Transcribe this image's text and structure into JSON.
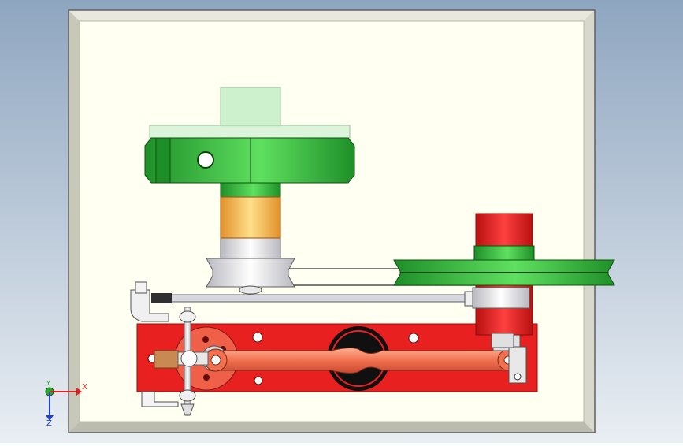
{
  "viewport": {
    "background_top": "#8fa6c0",
    "background_bottom": "#e9eef3"
  },
  "model": {
    "frame_color": "#fffff2",
    "frame_edge_color": "#b8b8a8",
    "upper_wheel": {
      "color": "#2fb83a",
      "hub_color": "#c8f0c8"
    },
    "shaft": {
      "color": "#f2b33a"
    },
    "small_pulley": {
      "color": "#e6e6e6"
    },
    "large_pulley": {
      "color": "#2fb83a"
    },
    "motor": {
      "color": "#e82020"
    },
    "base_plate": {
      "color": "#e82020"
    },
    "connecting_rod": {
      "color": "#f07050"
    },
    "rail": {
      "color": "#d8d8e0"
    }
  },
  "triad": {
    "x_label": "X",
    "y_label": "Y",
    "z_label": "Z",
    "x_color": "#e02020",
    "y_color": "#20b020",
    "z_color": "#2040d0"
  }
}
